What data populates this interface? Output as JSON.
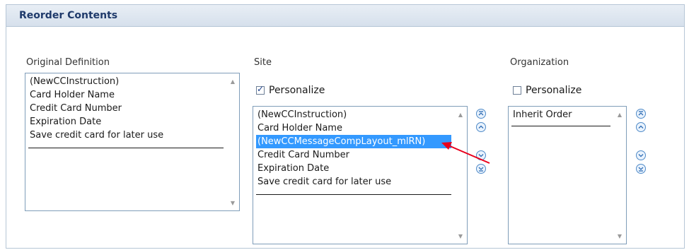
{
  "header": {
    "title": "Reorder Contents"
  },
  "original": {
    "label": "Original Definition",
    "items": [
      "(NewCCInstruction)",
      "Card Holder Name",
      "Credit Card Number",
      "Expiration Date",
      "Save credit card for later use"
    ]
  },
  "site": {
    "label": "Site",
    "personalize_label": "Personalize",
    "personalize_checked": true,
    "items": [
      "(NewCCInstruction)",
      "Card Holder Name",
      "(NewCCMessageCompLayout_mlRN)",
      "Credit Card Number",
      "Expiration Date",
      "Save credit card for later use"
    ],
    "selected_index": 2
  },
  "organization": {
    "label": "Organization",
    "personalize_label": "Personalize",
    "personalize_checked": false,
    "items": [
      "Inherit Order"
    ]
  },
  "icons": {
    "move_top": "move-to-top-icon",
    "move_up": "move-up-icon",
    "move_down": "move-down-icon",
    "move_bottom": "move-to-bottom-icon"
  },
  "colors": {
    "selection": "#3399ff",
    "header_text": "#1f3a6b",
    "arrow": "#e8001c"
  }
}
